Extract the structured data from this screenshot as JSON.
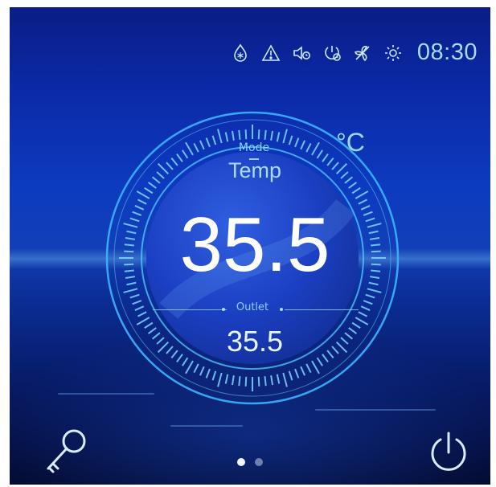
{
  "status_bar": {
    "icons": [
      "defrost-drop-icon",
      "warning-icon",
      "mute-timer-icon",
      "power-timer-icon",
      "fan-off-icon",
      "sun-icon"
    ],
    "time": "08:30"
  },
  "dial": {
    "unit": "°C",
    "mode_label": "Mode",
    "mode_value": "Temp",
    "main_value": "35.5",
    "outlet_label": "Outlet",
    "outlet_value": "35.5"
  },
  "bottom_bar": {
    "left_icon": "key-icon",
    "right_icon": "power-icon",
    "pages": 2,
    "active_page": 1
  },
  "colors": {
    "accent": "#a9dcff",
    "ring": "#4fc3ff",
    "text": "#ffffff"
  }
}
